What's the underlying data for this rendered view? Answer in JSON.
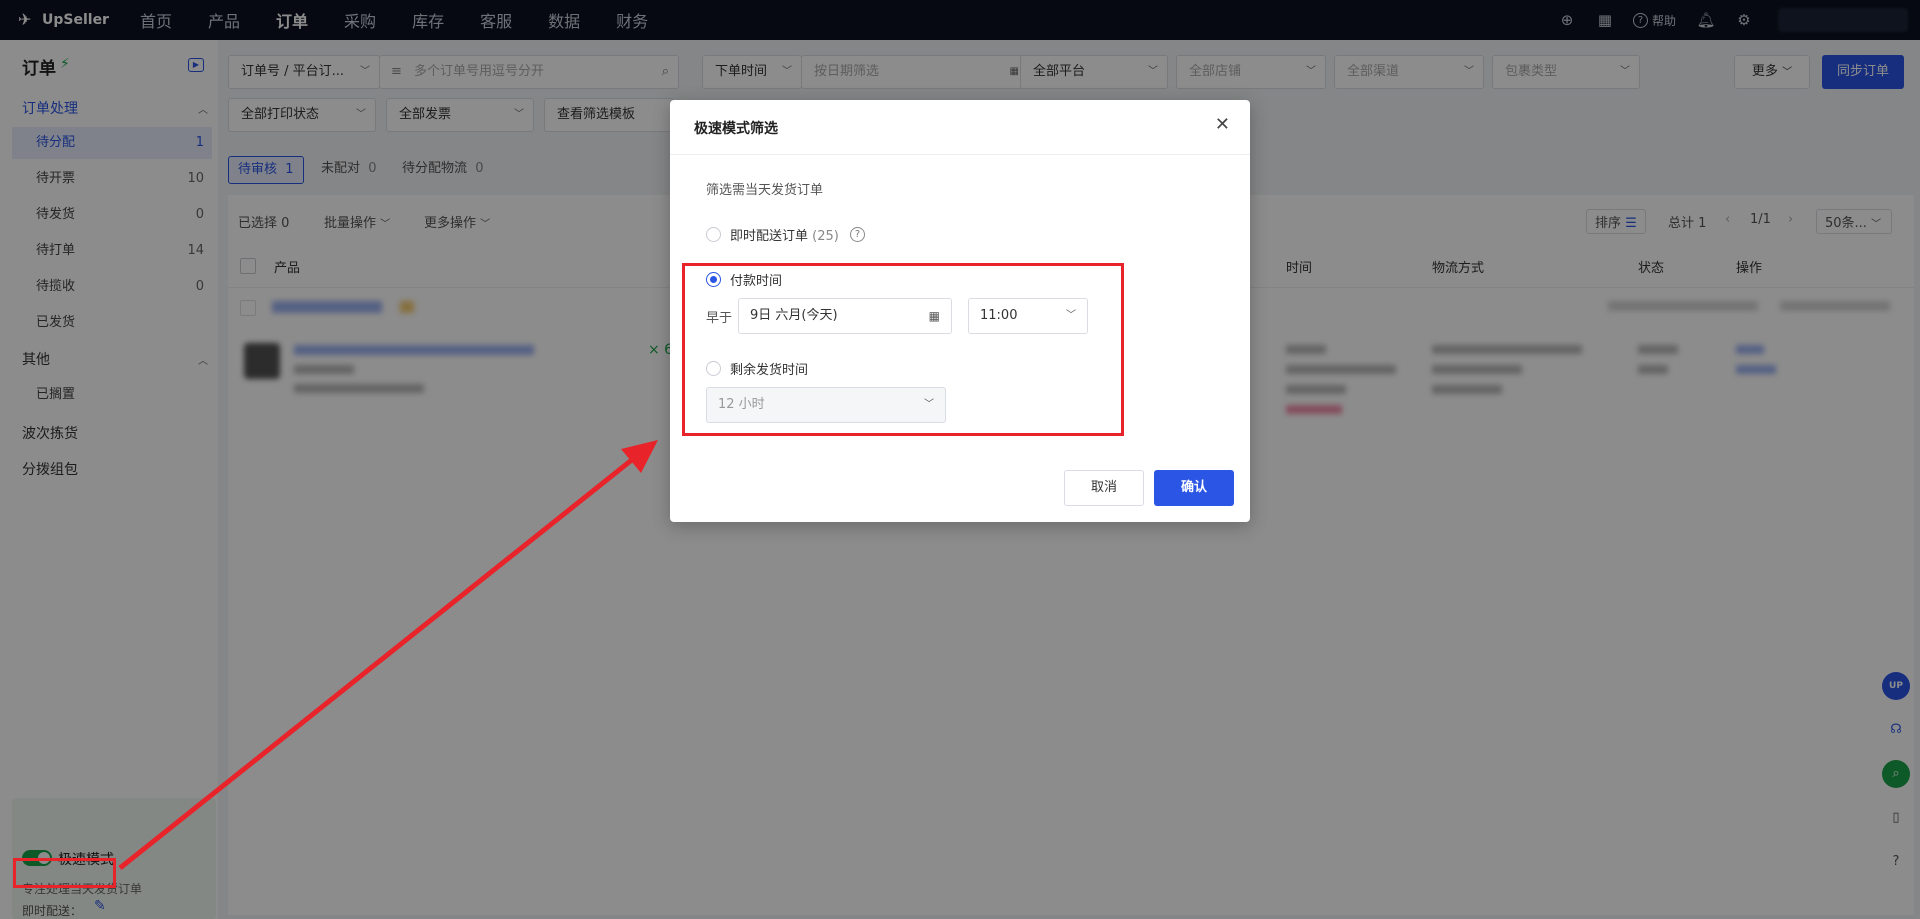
{
  "brand": {
    "name": "UpSeller"
  },
  "nav": {
    "items": [
      "首页",
      "产品",
      "订单",
      "采购",
      "库存",
      "客服",
      "数据",
      "财务"
    ],
    "active": "订单"
  },
  "top_right": {
    "help": "帮助"
  },
  "sidebar": {
    "title": "订单",
    "group_order": "订单处理",
    "items": [
      {
        "label": "待分配",
        "count": "1"
      },
      {
        "label": "待开票",
        "count": "10"
      },
      {
        "label": "待发货",
        "count": "0"
      },
      {
        "label": "待打单",
        "count": "14"
      },
      {
        "label": "待揽收",
        "count": "0"
      },
      {
        "label": "已发货",
        "count": ""
      }
    ],
    "group_other": "其他",
    "other_items": [
      {
        "label": "已搁置"
      }
    ],
    "extra": [
      "波次拣货",
      "分拨组包"
    ],
    "speed_mode": {
      "label": "极速模式",
      "desc": "专注处理当天发货订单",
      "instant": "即时配送："
    }
  },
  "filters": {
    "order_no": "订单号 / 平台订...",
    "search_placeholder": "多个订单号用逗号分开",
    "time": "下单时间",
    "date_placeholder": "按日期筛选",
    "platform": "全部平台",
    "store": "全部店铺",
    "channel": "全部渠道",
    "package": "包裹类型",
    "more": "更多",
    "sync": "同步订单",
    "print_status": "全部打印状态",
    "invoice": "全部发票",
    "view_template": "查看筛选模板"
  },
  "subtabs": [
    {
      "label": "待审核",
      "count": "1"
    },
    {
      "label": "未配对",
      "count": "0"
    },
    {
      "label": "待分配物流",
      "count": "0"
    }
  ],
  "table": {
    "selected": "已选择 0",
    "batch": "批量操作",
    "more_ops": "更多操作",
    "sort": "排序",
    "total": "总计 1",
    "page": "1/1",
    "per_page": "50条...",
    "headers": [
      "产品",
      "时间",
      "物流方式",
      "状态",
      "操作"
    ],
    "qty": "× 6"
  },
  "modal": {
    "title": "极速模式筛选",
    "subtitle": "筛选需当天发货订单",
    "opt_instant": "即时配送订单",
    "opt_instant_count": "(25)",
    "opt_pay_time": "付款时间",
    "earlier_than": "早于",
    "date_value": "9日 六月(今天)",
    "time_value": "11:00",
    "opt_remaining": "剩余发货时间",
    "remaining_value": "12 小时",
    "cancel": "取消",
    "confirm": "确认"
  },
  "colors": {
    "primary": "#2a55e5",
    "highlight": "#e8232a",
    "topbar": "#0b1220",
    "success": "#1aa34a"
  }
}
